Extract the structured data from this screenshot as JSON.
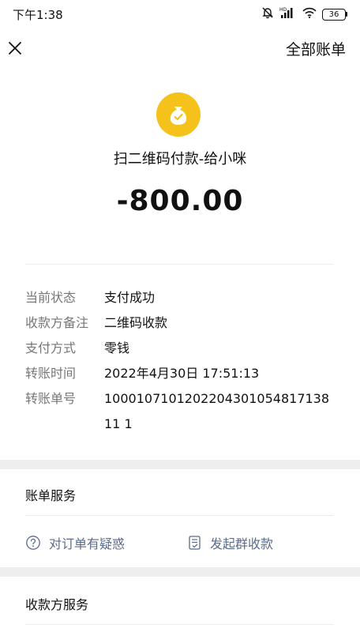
{
  "status_bar": {
    "time": "下午1:38",
    "battery": "36",
    "signal_label": "HD"
  },
  "nav": {
    "all_bills": "全部账单"
  },
  "header": {
    "merchant_title": "扫二维码付款-给小咪",
    "amount": "-800.00",
    "icon_color": "#f5c21b"
  },
  "details": [
    {
      "label": "当前状态",
      "value": "支付成功"
    },
    {
      "label": "收款方备注",
      "value": "二维码收款"
    },
    {
      "label": "支付方式",
      "value": "零钱"
    },
    {
      "label": "转账时间",
      "value": "2022年4月30日 17:51:13"
    },
    {
      "label": "转账单号",
      "value": "100010710120220430105481713811 1"
    }
  ],
  "bill_service": {
    "title": "账单服务",
    "actions": [
      {
        "label": "对订单有疑惑",
        "icon": "question-circle-icon"
      },
      {
        "label": "发起群收款",
        "icon": "document-icon"
      }
    ]
  },
  "payee_service": {
    "title": "收款方服务"
  },
  "colors": {
    "link": "#5b6b8a",
    "label": "#777777",
    "gap": "#eeeeee"
  }
}
